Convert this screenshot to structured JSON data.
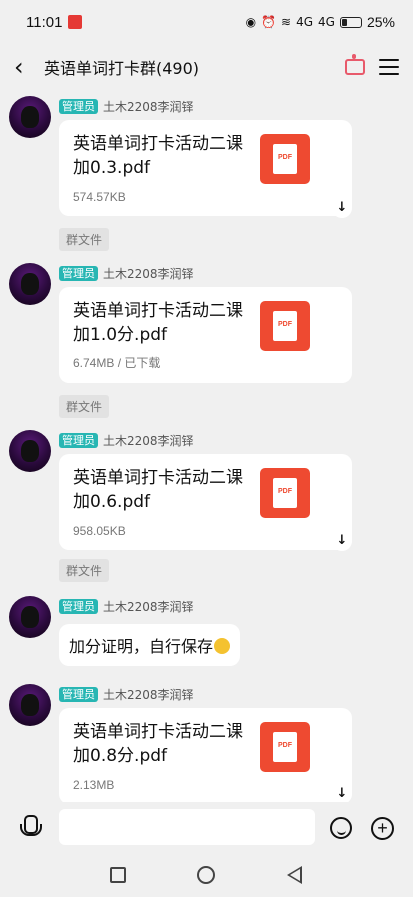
{
  "status": {
    "time": "11:01",
    "battery": "25%",
    "battery_level": 0.25,
    "network": "4G"
  },
  "header": {
    "title": "英语单词打卡群(490)"
  },
  "messages": [
    {
      "badge": "管理员",
      "sender": "土木2208李润铎",
      "file_name": "英语单词打卡活动二课加0.3.pdf",
      "file_meta": "574.57KB",
      "file_type": "PDF",
      "tag": "群文件"
    },
    {
      "badge": "管理员",
      "sender": "土木2208李润铎",
      "file_name": "英语单词打卡活动二课加1.0分.pdf",
      "file_meta": "6.74MB / 已下载",
      "file_type": "PDF",
      "tag": "群文件"
    },
    {
      "badge": "管理员",
      "sender": "土木2208李润铎",
      "file_name": "英语单词打卡活动二课加0.6.pdf",
      "file_meta": "958.05KB",
      "file_type": "PDF",
      "tag": "群文件"
    },
    {
      "badge": "管理员",
      "sender": "土木2208李润铎",
      "text": "加分证明，自行保存"
    },
    {
      "badge": "管理员",
      "sender": "土木2208李润铎",
      "file_name": "英语单词打卡活动二课加0.8分.pdf",
      "file_meta": "2.13MB",
      "file_type": "PDF"
    }
  ],
  "icons": {
    "download": "↓"
  },
  "colors": {
    "admin_badge": "#27b6b3",
    "pdf": "#ee4a31",
    "accent": "#e85a6b"
  }
}
